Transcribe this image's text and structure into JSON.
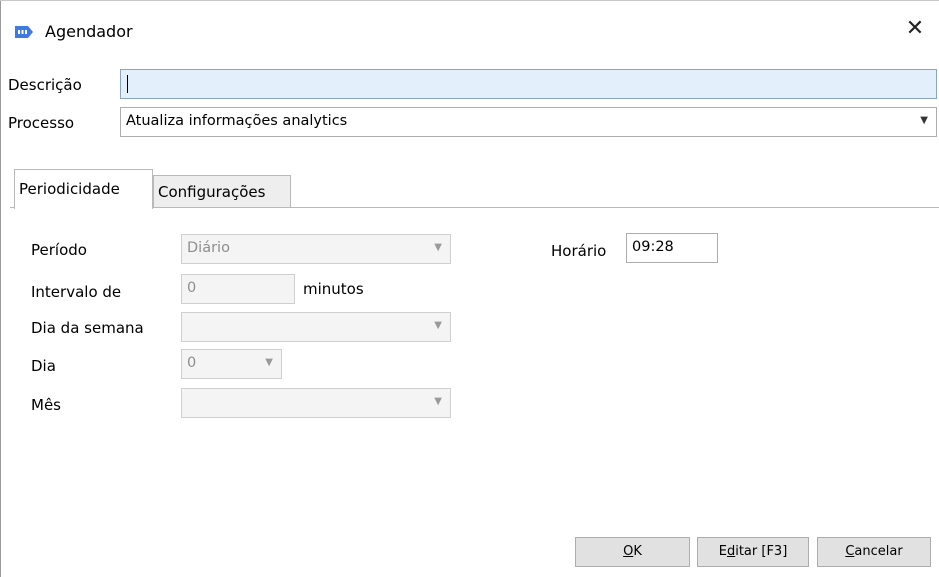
{
  "window": {
    "title": "Agendador",
    "close_glyph": "✕",
    "icon": "app-tag-icon",
    "accent": "#3d7be0"
  },
  "form": {
    "descricao": {
      "label": "Descrição",
      "value": ""
    },
    "processo": {
      "label": "Processo",
      "value": "Atualiza informações analytics"
    }
  },
  "tabs": [
    {
      "label": "Periodicidade",
      "active": true
    },
    {
      "label": "Configurações",
      "active": false
    }
  ],
  "periodicidade": {
    "periodo": {
      "label": "Período",
      "value": "Diário"
    },
    "intervalo": {
      "label": "Intervalo de",
      "value": "0",
      "suffix": "minutos"
    },
    "dia_semana": {
      "label": "Dia da semana",
      "value": ""
    },
    "dia": {
      "label": "Dia",
      "value": "0"
    },
    "mes": {
      "label": "Mês",
      "value": ""
    },
    "horario": {
      "label": "Horário",
      "value": "09:28"
    }
  },
  "buttons": {
    "ok": {
      "mnemonic": "O",
      "rest": "K"
    },
    "editar": {
      "pre": "E",
      "mnemonic": "d",
      "rest": "itar [F3]"
    },
    "cancelar": {
      "mnemonic": "C",
      "rest": "ancelar"
    }
  }
}
